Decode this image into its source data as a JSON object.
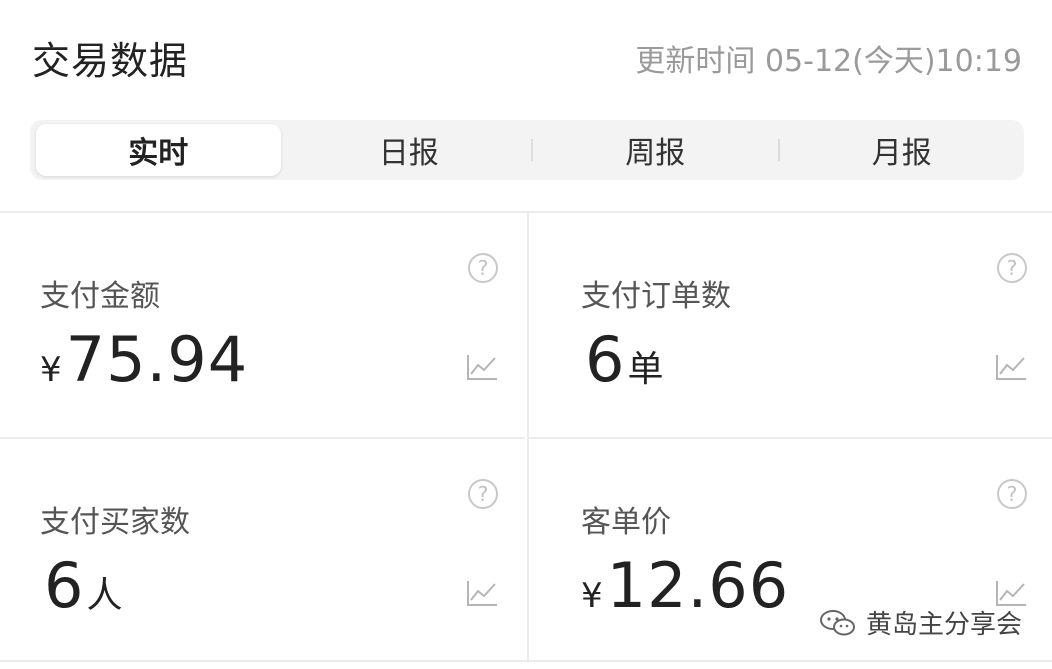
{
  "header": {
    "title": "交易数据",
    "updated_label": "更新时间",
    "updated_value": "05-12(今天)10:19"
  },
  "tabs": [
    {
      "label": "实时",
      "active": true
    },
    {
      "label": "日报",
      "active": false
    },
    {
      "label": "周报",
      "active": false
    },
    {
      "label": "月报",
      "active": false
    }
  ],
  "metrics": [
    {
      "label": "支付金额",
      "currency": "¥",
      "value": "75.94",
      "unit": ""
    },
    {
      "label": "支付订单数",
      "currency": "",
      "value": "6",
      "unit": "单"
    },
    {
      "label": "支付买家数",
      "currency": "",
      "value": "6",
      "unit": "人"
    },
    {
      "label": "客单价",
      "currency": "¥",
      "value": "12.66",
      "unit": ""
    }
  ],
  "icons": {
    "help": "question-circle-icon",
    "trend": "trend-chart-icon",
    "watermark": "wechat-icon"
  },
  "watermark": {
    "text": "黄岛主分享会"
  },
  "colors": {
    "text_dark": "#222222",
    "text_muted": "#9a9a9a",
    "tab_bg": "#f3f3f3",
    "divider": "#ececec"
  }
}
